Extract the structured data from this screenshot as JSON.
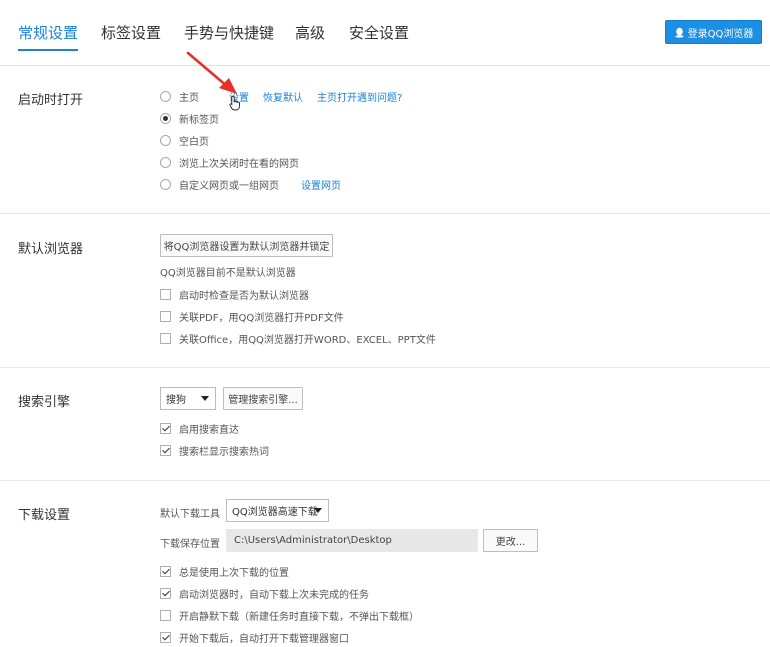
{
  "tabs": [
    "常规设置",
    "标签设置",
    "手势与快捷键",
    "高级",
    "安全设置"
  ],
  "login_button": "登录QQ浏览器",
  "startup": {
    "title": "启动时打开",
    "options": [
      {
        "label": "主页",
        "checked": false
      },
      {
        "label": "新标签页",
        "checked": true
      },
      {
        "label": "空白页",
        "checked": false
      },
      {
        "label": "浏览上次关闭时在看的网页",
        "checked": false
      },
      {
        "label": "自定义网页或一组网页",
        "checked": false
      }
    ],
    "homepage_links": [
      "设置",
      "恢复默认",
      "主页打开遇到问题?"
    ],
    "custom_link": "设置网页"
  },
  "default_browser": {
    "title": "默认浏览器",
    "set_button": "将QQ浏览器设置为默认浏览器并锁定",
    "status": "QQ浏览器目前不是默认浏览器",
    "options": [
      {
        "label": "启动时检查是否为默认浏览器",
        "checked": false
      },
      {
        "label": "关联PDF，用QQ浏览器打开PDF文件",
        "checked": false
      },
      {
        "label": "关联Office，用QQ浏览器打开WORD、EXCEL、PPT文件",
        "checked": false
      }
    ]
  },
  "search": {
    "title": "搜索引擎",
    "engine": "搜狗",
    "manage_button": "管理搜索引擎...",
    "options": [
      {
        "label": "启用搜索直达",
        "checked": true
      },
      {
        "label": "搜索栏显示搜索热词",
        "checked": true
      }
    ]
  },
  "download": {
    "title": "下载设置",
    "tool_label": "默认下载工具",
    "tool_value": "QQ浏览器高速下载",
    "path_label": "下载保存位置",
    "path_value": "C:\\Users\\Administrator\\Desktop",
    "change_button": "更改...",
    "options": [
      {
        "label": "总是使用上次下载的位置",
        "checked": true
      },
      {
        "label": "启动浏览器时，自动下载上次未完成的任务",
        "checked": true
      },
      {
        "label": "开启静默下载（新建任务时直接下载，不弹出下载框）",
        "checked": false
      },
      {
        "label": "开始下载后，自动打开下载管理器窗口",
        "checked": true
      }
    ]
  },
  "colors": {
    "accent": "#1a82d9",
    "button_blue": "#1a8fe3",
    "arrow_red": "#e8302a"
  }
}
